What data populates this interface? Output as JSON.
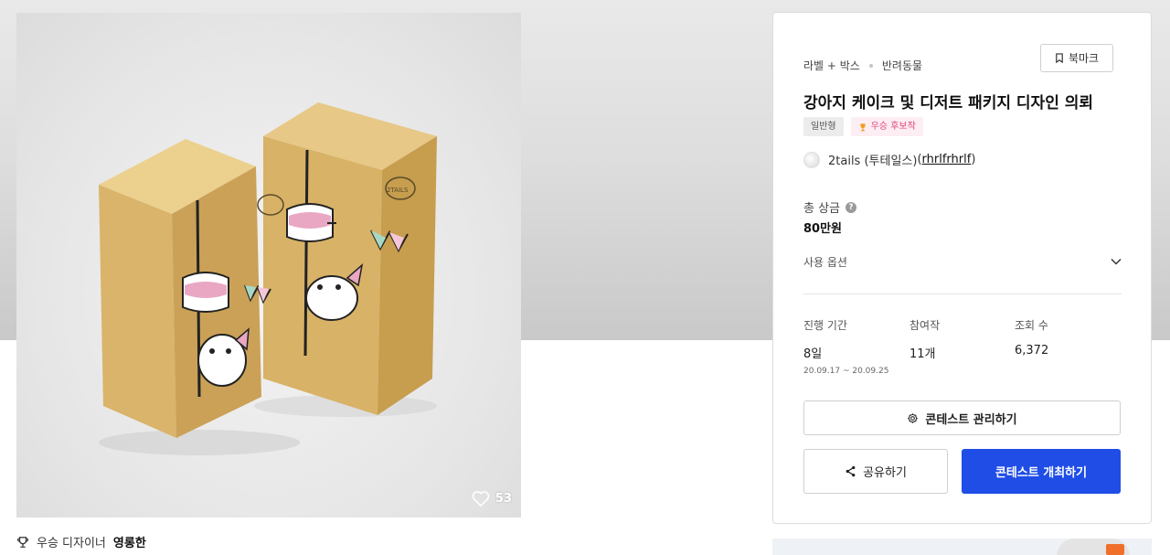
{
  "gallery": {
    "like_count": "53",
    "box_brand": "2TAILS",
    "winner_prefix": "우승 디자이너",
    "winner_name": "영롱한"
  },
  "contest": {
    "categories": [
      "라벨 + 박스",
      "반려동물"
    ],
    "bookmark_label": "북마크",
    "title": "강아지 케이크 및 디저트 패키지 디자인 의뢰",
    "tags": {
      "type": "일반형",
      "winner": "우승 후보작"
    },
    "host": {
      "name": "2tails (투테일스)",
      "id_open": "(",
      "id": "rhrlfrhrlf",
      "id_close": ")"
    },
    "prize": {
      "label": "총 상금",
      "help": "?",
      "value": "80만원"
    },
    "usage_options_label": "사용 옵션",
    "stats": {
      "period_label": "진행 기간",
      "period_value": "8일",
      "period_dates": "20.09.17 ~ 20.09.25",
      "entries_label": "참여작",
      "entries_value": "11개",
      "views_label": "조회 수",
      "views_value": "6,372"
    },
    "buttons": {
      "manage": "콘테스트 관리하기",
      "share": "공유하기",
      "host": "콘테스트 개최하기"
    }
  },
  "colors": {
    "primary": "#1f4de6",
    "winner_tag_text": "#e0457b",
    "winner_tag_bg": "#fdeef3",
    "box": "#d9b46a"
  },
  "icons": {
    "bookmark": "bookmark-icon",
    "trophy": "trophy-icon",
    "gear": "gear-icon",
    "share": "share-icon",
    "chevron": "chevron-down-icon",
    "heart": "heart-icon"
  }
}
